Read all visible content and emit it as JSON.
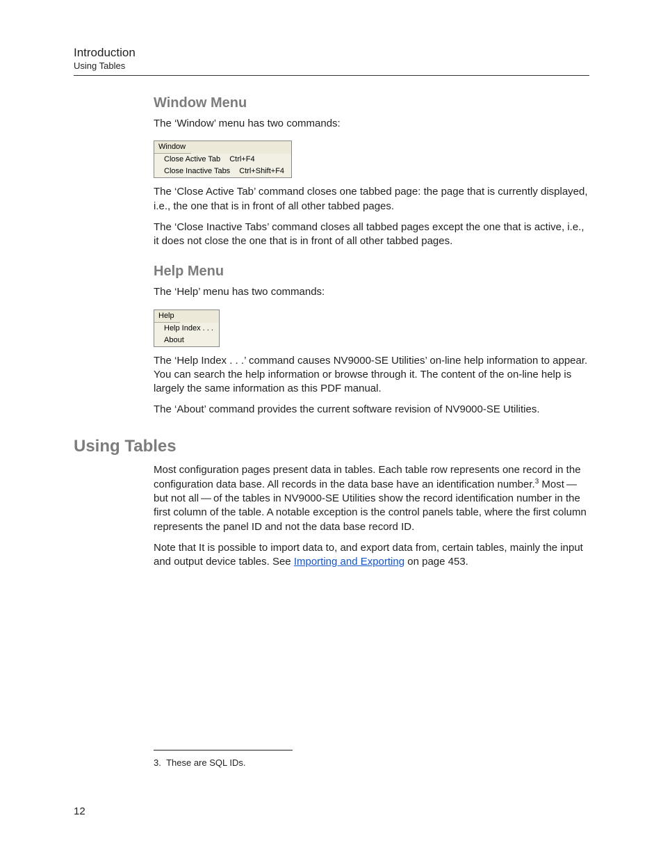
{
  "header": {
    "title": "Introduction",
    "subtitle": "Using Tables"
  },
  "sections": {
    "window_menu": {
      "heading": "Window Menu",
      "intro": "The ‘Window’ menu has two commands:",
      "menu_title": "Window",
      "items": [
        {
          "label": "Close Active Tab",
          "shortcut": "Ctrl+F4"
        },
        {
          "label": "Close Inactive Tabs",
          "shortcut": "Ctrl+Shift+F4"
        }
      ],
      "para1": "The ‘Close Active Tab’ command closes one tabbed page: the page that is currently displayed, i.e., the one that is in front of all other tabbed pages.",
      "para2": "The ‘Close Inactive Tabs’ command closes all tabbed pages except the one that is active, i.e., it does not close the one that is in front of all other tabbed pages."
    },
    "help_menu": {
      "heading": "Help Menu",
      "intro": "The ‘Help’ menu has two commands:",
      "menu_title": "Help",
      "items": [
        {
          "label": "Help Index . . ."
        },
        {
          "label": "About"
        }
      ],
      "para1": "The ‘Help Index . . .’ command causes NV9000-SE Utilities’ on-line help information to appear. You can search the help information or browse through it. The content of the on-line help is largely the same information as this PDF manual.",
      "para2": "The ‘About’ command provides the current software revision of NV9000-SE Utilities."
    },
    "using_tables": {
      "heading": "Using Tables",
      "para1_a": "Most configuration pages present data in tables. Each table row represents one record in the configuration data base. All records in the data base have an identification number.",
      "para1_sup": "3",
      "para1_b": " Most — but not all — of the tables in NV9000-SE Utilities show the record identification number in the first column of the table. A notable exception is the control panels table, where the first column represents the panel ID and not the data base record ID.",
      "para2_a": "Note that It is possible to import data to, and export data from, certain tables, mainly the input and output device tables. See ",
      "para2_link": "Importing and Exporting",
      "para2_b": " on page 453."
    }
  },
  "footnote": {
    "marker": "3.",
    "text": "These are SQL IDs."
  },
  "page_number": "12"
}
